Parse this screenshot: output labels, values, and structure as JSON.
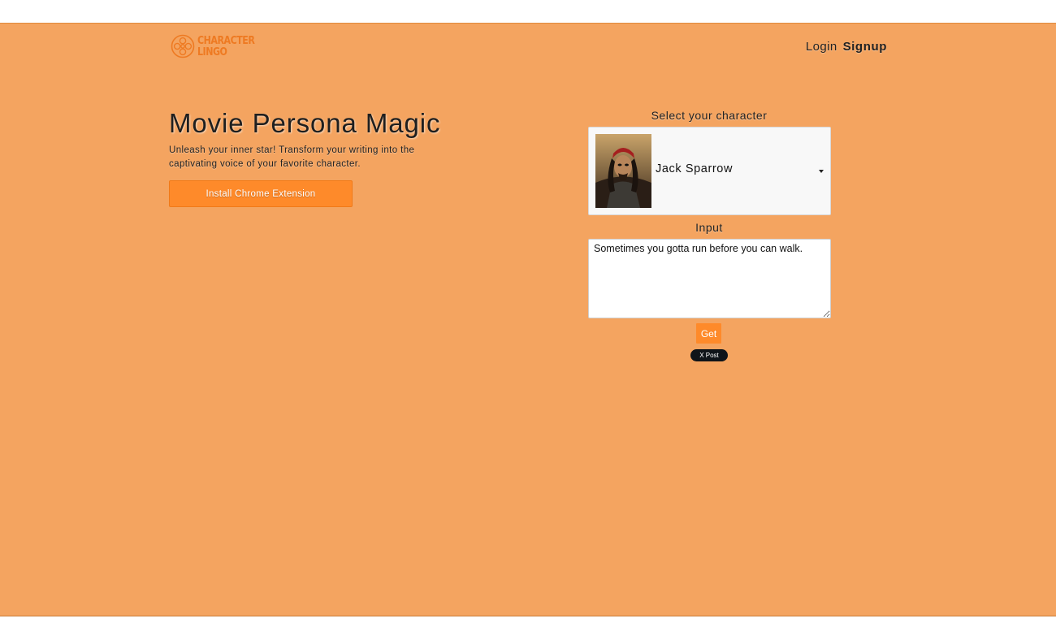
{
  "header": {
    "logo_lines": [
      "CHARACTER",
      "LINGO"
    ],
    "logo_icon": "film-reel-icon",
    "nav": {
      "login_label": "Login",
      "signup_label": "Signup"
    }
  },
  "hero": {
    "title": "Movie Persona Magic",
    "subtitle": "Unleash your inner star! Transform your writing into the captivating voice of your favorite character.",
    "install_button_label": "Install Chrome Extension"
  },
  "converter": {
    "select_label": "Select your character",
    "selected_character": "Jack Sparrow",
    "input_label": "Input",
    "input_value": "Sometimes you gotta run before you can walk.",
    "get_button_label": "Get",
    "x_post_label": "X Post"
  },
  "colors": {
    "background": "#f4a460",
    "accent": "#fe8a2a",
    "logo": "#ee7a22"
  }
}
